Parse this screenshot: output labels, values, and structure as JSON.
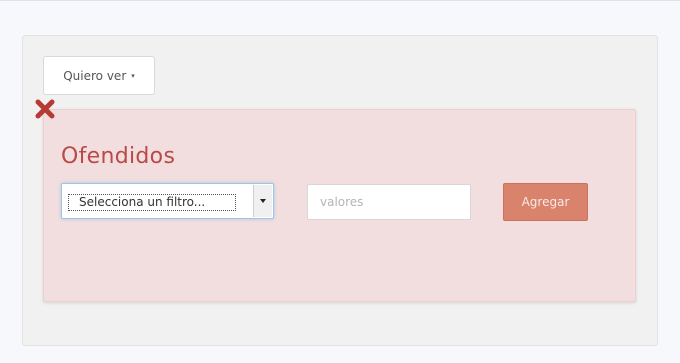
{
  "toolbar": {
    "view_button_label": "Quiero ver",
    "view_button_caret": "▾"
  },
  "filter_card": {
    "title": "Ofendidos",
    "close_icon": "close-x-icon",
    "select": {
      "selected_label": "Selecciona un filtro..."
    },
    "values_input": {
      "value": "",
      "placeholder": "valores"
    },
    "add_button_label": "Agregar"
  },
  "colors": {
    "card_background": "#f2dede",
    "card_title": "#b94a48",
    "close_icon": "#b83a36",
    "add_button": "#d9826c"
  }
}
